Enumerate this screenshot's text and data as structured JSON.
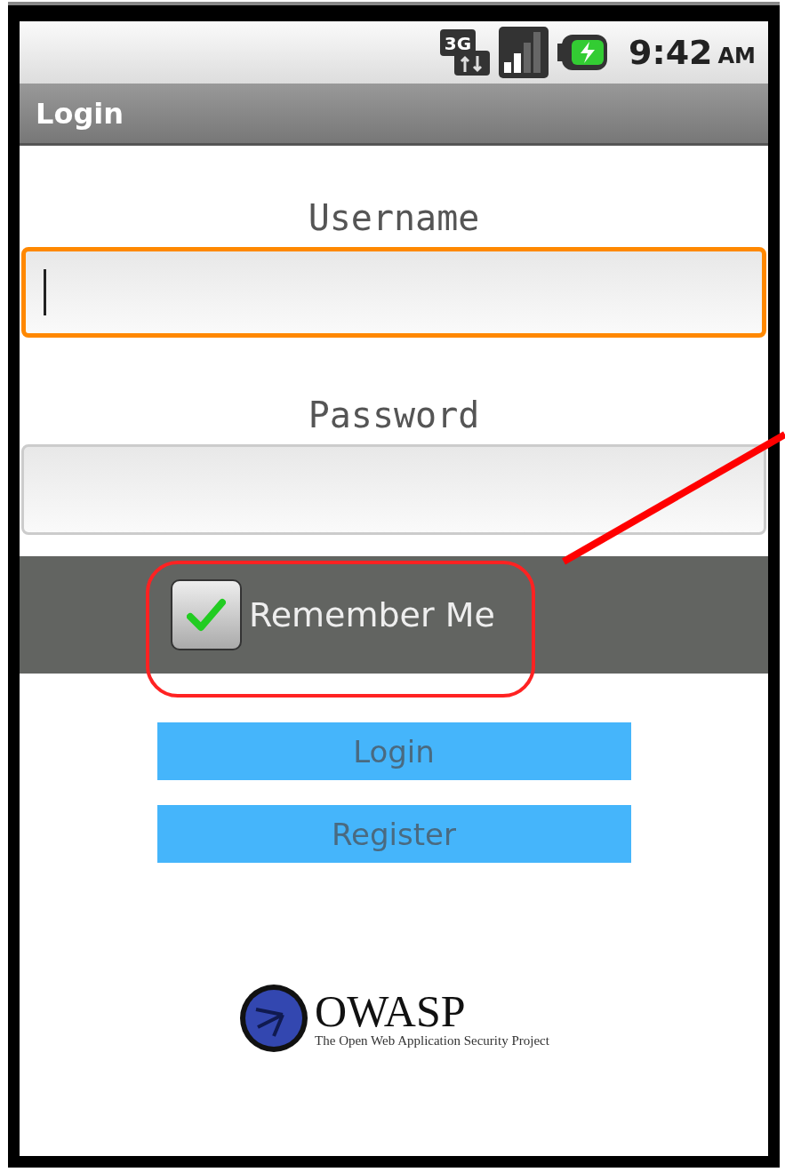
{
  "status_bar": {
    "time": "9:42",
    "period": "AM",
    "network": "3G"
  },
  "title_bar": {
    "title": "Login"
  },
  "fields": [
    {
      "label": "Username",
      "focused": true
    },
    {
      "label": "Password",
      "focused": false
    }
  ],
  "remember": {
    "label": "Remember Me",
    "checked": true
  },
  "buttons": [
    "Login",
    "Register"
  ],
  "logo": {
    "name": "OWASP",
    "tagline": "The Open Web Application Security Project"
  }
}
